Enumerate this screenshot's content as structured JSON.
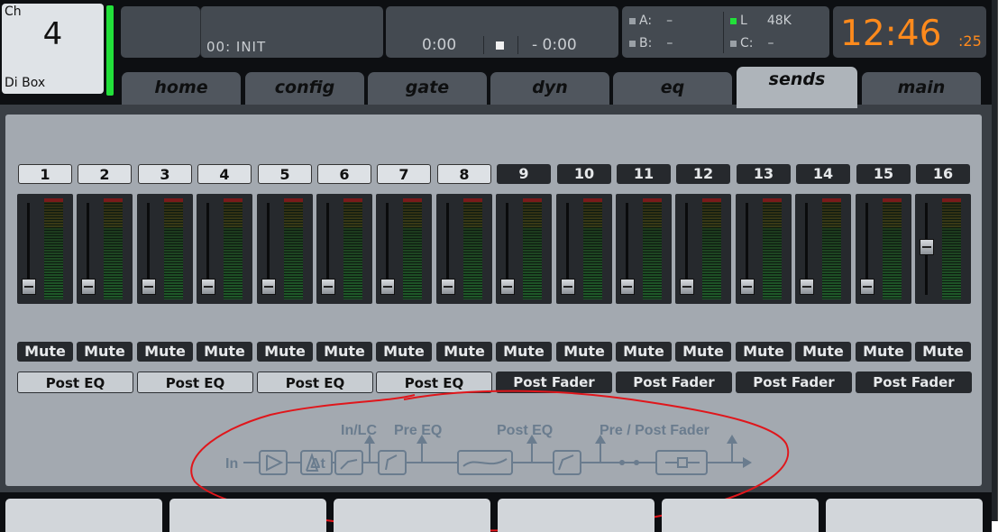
{
  "channel": {
    "label": "Ch",
    "number": "4",
    "name": "Di Box"
  },
  "scene": {
    "text": "00: INIT"
  },
  "transport": {
    "elapsed": "0:00",
    "remaining": "- 0:00"
  },
  "usb": {
    "a": "A:",
    "a_val": "–",
    "b": "B:",
    "b_val": "–",
    "l": "L",
    "rate": "48K",
    "c": "C:",
    "c_val": "–"
  },
  "clock": {
    "time": "12:46",
    "seconds": ":25"
  },
  "tabs": [
    "home",
    "config",
    "gate",
    "dyn",
    "eq",
    "sends",
    "main"
  ],
  "active_tab": "sends",
  "buses": [
    {
      "num": "1",
      "level": 0.05
    },
    {
      "num": "2",
      "level": 0.05
    },
    {
      "num": "3",
      "level": 0.05
    },
    {
      "num": "4",
      "level": 0.05
    },
    {
      "num": "5",
      "level": 0.05
    },
    {
      "num": "6",
      "level": 0.05
    },
    {
      "num": "7",
      "level": 0.05
    },
    {
      "num": "8",
      "level": 0.05
    },
    {
      "num": "9",
      "level": 0.05
    },
    {
      "num": "10",
      "level": 0.05
    },
    {
      "num": "11",
      "level": 0.05
    },
    {
      "num": "12",
      "level": 0.05
    },
    {
      "num": "13",
      "level": 0.05
    },
    {
      "num": "14",
      "level": 0.05
    },
    {
      "num": "15",
      "level": 0.05
    },
    {
      "num": "16",
      "level": 0.55
    }
  ],
  "mute_label": "Mute",
  "taps": [
    "Post EQ",
    "Post EQ",
    "Post EQ",
    "Post EQ",
    "Post Fader",
    "Post Fader",
    "Post Fader",
    "Post Fader"
  ],
  "flow": {
    "in": "In",
    "in_lc": "In/LC",
    "pre_eq": "Pre EQ",
    "post_eq": "Post EQ",
    "pre_post_fader": "Pre / Post Fader"
  },
  "colors": {
    "accent_green": "#22e03a",
    "clock_orange": "#ff8a1c",
    "annotation_red": "#e0161b"
  }
}
